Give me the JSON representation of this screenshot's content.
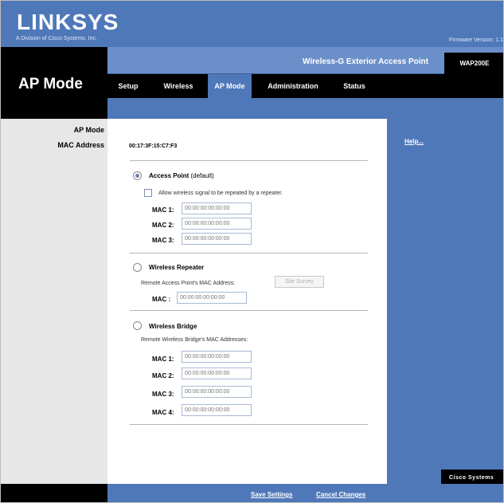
{
  "header": {
    "logo": "LINKSYS",
    "logo_sub": "A Division of Cisco Systems, Inc.",
    "firmware": "Firmware Version: 1.1"
  },
  "page_title": "AP Mode",
  "product": {
    "name": "Wireless-G Exterior Access Point",
    "model": "WAP200E"
  },
  "tabs": [
    {
      "label": "Setup"
    },
    {
      "label": "Wireless"
    },
    {
      "label": "AP Mode"
    },
    {
      "label": "Administration"
    },
    {
      "label": "Status"
    }
  ],
  "sidebar": {
    "ap_mode": "AP Mode",
    "mac_address": "MAC Address"
  },
  "main": {
    "mac_address_value": "00:17:3F:15:C7:F3",
    "access_point": {
      "label": "Access Point",
      "suffix": "(default)",
      "repeat_checkbox": "Allow wireless signal to be repeated by a repeater.",
      "macs": [
        {
          "label": "MAC 1:",
          "placeholder": "00:00:00:00:00:00"
        },
        {
          "label": "MAC 2:",
          "placeholder": "00:00:00:00:00:00"
        },
        {
          "label": "MAC 3:",
          "placeholder": "00:00:00:00:00:00"
        }
      ]
    },
    "wireless_repeater": {
      "label": "Wireless Repeater",
      "remote_label": "Remote Access Point's MAC Address:",
      "site_survey": "Site Survey",
      "mac_label": "MAC :",
      "mac_placeholder": "00:00:00:00:00:00"
    },
    "wireless_bridge": {
      "label": "Wireless Bridge",
      "remote_label": "Remote Wireless Bridge's MAC Addresses:",
      "macs": [
        {
          "label": "MAC 1:",
          "placeholder": "00:00:00:00:00:00"
        },
        {
          "label": "MAC 2:",
          "placeholder": "00:00:00:00:00:00"
        },
        {
          "label": "MAC 3:",
          "placeholder": "00:00:00:00:00:00"
        },
        {
          "label": "MAC 4:",
          "placeholder": "00:00:00:00:00:00"
        }
      ]
    }
  },
  "right_panel": {
    "help": "Help...",
    "cisco": "Cisco Systems"
  },
  "footer": {
    "save": "Save Settings",
    "cancel": "Cancel Changes"
  },
  "colors": {
    "brand_blue": "#4f78b9",
    "black": "#000000"
  }
}
